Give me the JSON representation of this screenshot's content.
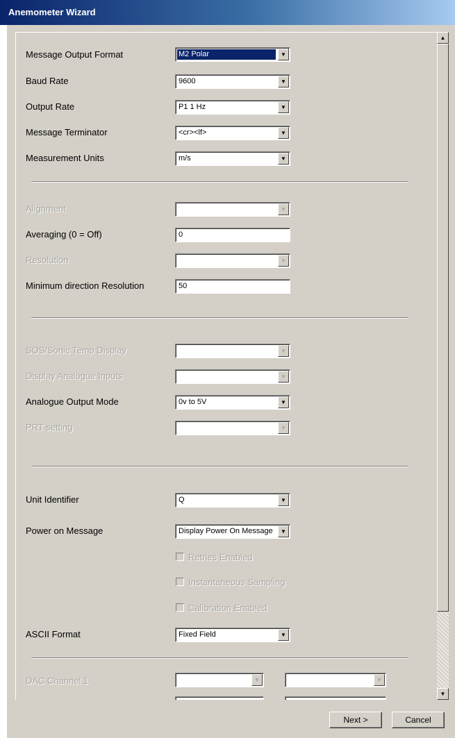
{
  "window": {
    "title": "Anemometer Wizard"
  },
  "section1": {
    "message_output_format": {
      "label": "Message Output Format",
      "value": "M2 Polar"
    },
    "baud_rate": {
      "label": "Baud Rate",
      "value": "9600"
    },
    "output_rate": {
      "label": "Output Rate",
      "value": "P1 1 Hz"
    },
    "message_terminator": {
      "label": "Message Terminator",
      "value": "<cr><lf>"
    },
    "measurement_units": {
      "label": "Measurement Units",
      "value": "m/s"
    }
  },
  "section2": {
    "alignment": {
      "label": "Alignment",
      "value": ""
    },
    "averaging": {
      "label": "Averaging (0 = Off)",
      "value": "0"
    },
    "resolution": {
      "label": "Resolution",
      "value": ""
    },
    "min_dir_resolution": {
      "label": "Minimum direction Resolution",
      "value": "50"
    }
  },
  "section3": {
    "sos_display": {
      "label": "SOS/Sonic Temp Display",
      "value": ""
    },
    "display_analogue": {
      "label": "Display Analogue Inputs",
      "value": ""
    },
    "analogue_output_mode": {
      "label": "Analogue Output  Mode",
      "value": "0v to 5V"
    },
    "prt_setting": {
      "label": "PRT setting",
      "value": ""
    }
  },
  "section4": {
    "unit_identifier": {
      "label": "Unit Identifier",
      "value": "Q"
    },
    "power_on_message": {
      "label": "Power on Message",
      "value": "Display Power On Message"
    },
    "retries_enabled": {
      "label": "Retries Enabled",
      "checked": false
    },
    "instantaneous_sampling": {
      "label": "Instantaneous Sampling",
      "checked": false
    },
    "calibration_enabled": {
      "label": "Calibration Enabled",
      "checked": false
    },
    "ascii_format": {
      "label": "ASCII Format",
      "value": "Fixed Field"
    }
  },
  "section5": {
    "dac_channel_1": {
      "label": "DAC Channel 1",
      "value_a": "",
      "value_b": ""
    }
  },
  "buttons": {
    "next": "Next >",
    "cancel": "Cancel"
  },
  "icons": {
    "dropdown": "chevron-down-icon",
    "scroll_up": "arrow-up-icon",
    "scroll_down": "arrow-down-icon"
  }
}
